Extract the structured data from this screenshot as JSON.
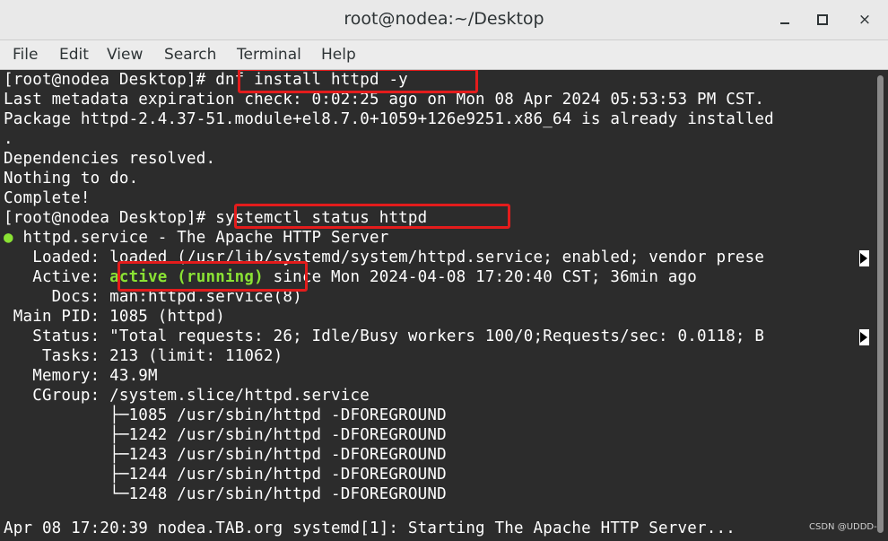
{
  "window": {
    "title": "root@nodea:~/Desktop",
    "minimize_label": "minimize",
    "maximize_label": "maximize",
    "close_label": "×"
  },
  "menu": [
    "File",
    "Edit",
    "View",
    "Search",
    "Terminal",
    "Help"
  ],
  "terminal": {
    "lines": [
      {
        "prompt": "[root@nodea Desktop]# ",
        "text": "dnf install httpd -y"
      },
      {
        "text": "Last metadata expiration check: 0:02:25 ago on Mon 08 Apr 2024 05:53:53 PM CST."
      },
      {
        "text": "Package httpd-2.4.37-51.module+el8.7.0+1059+126e9251.x86_64 is already installed"
      },
      {
        "text": "."
      },
      {
        "text": "Dependencies resolved."
      },
      {
        "text": "Nothing to do."
      },
      {
        "text": "Complete!"
      },
      {
        "prompt": "[root@nodea Desktop]# ",
        "text": "systemctl status httpd"
      },
      {
        "bullet": "●",
        "text": " httpd.service - The Apache HTTP Server"
      },
      {
        "text": "   Loaded: loaded (/usr/lib/systemd/system/httpd.service; enabled; vendor prese"
      },
      {
        "label": "   Active: ",
        "status": "active (running)",
        "text": " since Mon 2024-04-08 17:20:40 CST; 36min ago"
      },
      {
        "text": "     Docs: man:httpd.service(8)"
      },
      {
        "text": " Main PID: 1085 (httpd)"
      },
      {
        "text": "   Status: \"Total requests: 26; Idle/Busy workers 100/0;Requests/sec: 0.0118; B"
      },
      {
        "text": "    Tasks: 213 (limit: 11062)"
      },
      {
        "text": "   Memory: 43.9M"
      },
      {
        "text": "   CGroup: /system.slice/httpd.service"
      },
      {
        "text": "           ├─1085 /usr/sbin/httpd -DFOREGROUND"
      },
      {
        "text": "           ├─1242 /usr/sbin/httpd -DFOREGROUND"
      },
      {
        "text": "           ├─1243 /usr/sbin/httpd -DFOREGROUND"
      },
      {
        "text": "           ├─1244 /usr/sbin/httpd -DFOREGROUND"
      },
      {
        "text": "           └─1248 /usr/sbin/httpd -DFOREGROUND"
      },
      {
        "text": ""
      },
      {
        "text": "Apr 08 17:20:39 nodea.TAB.org systemd[1]: Starting The Apache HTTP Server..."
      }
    ]
  },
  "watermark": "CSDN @UDDD-",
  "colors": {
    "terminal_bg": "#2c2c2c",
    "terminal_fg": "#ffffff",
    "status_green": "#8ae234",
    "highlight_red": "#e31c1c"
  }
}
